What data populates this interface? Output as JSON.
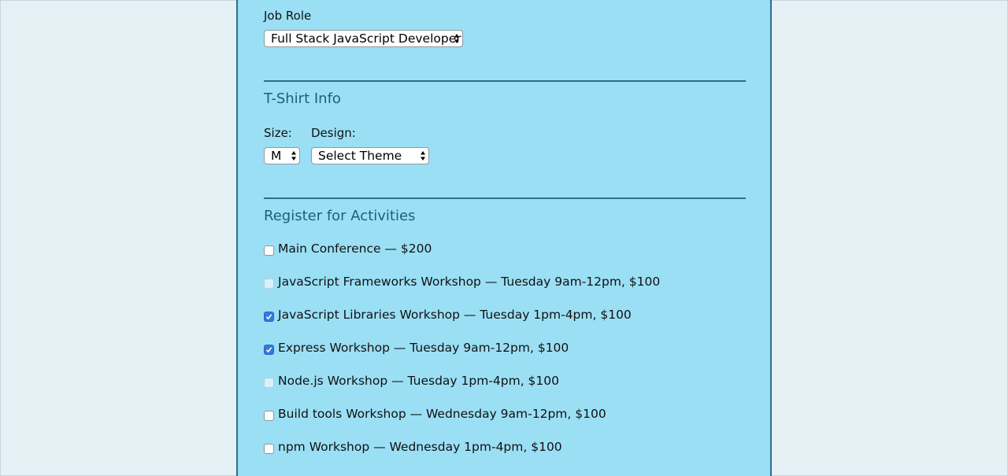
{
  "job_role": {
    "label": "Job Role",
    "selected": "Full Stack JavaScript Developer"
  },
  "tshirt": {
    "title": "T-Shirt Info",
    "size_label": "Size:",
    "size_selected": "M",
    "design_label": "Design:",
    "design_selected": "Select Theme"
  },
  "activities": {
    "title": "Register for Activities",
    "items": [
      {
        "label": "Main Conference — $200",
        "checked": false,
        "disabled": false
      },
      {
        "label": "JavaScript Frameworks Workshop — Tuesday 9am-12pm, $100",
        "checked": false,
        "disabled": true
      },
      {
        "label": "JavaScript Libraries Workshop — Tuesday 1pm-4pm, $100",
        "checked": true,
        "disabled": false
      },
      {
        "label": "Express Workshop — Tuesday 9am-12pm, $100",
        "checked": true,
        "disabled": false
      },
      {
        "label": "Node.js Workshop — Tuesday 1pm-4pm, $100",
        "checked": false,
        "disabled": true
      },
      {
        "label": "Build tools Workshop — Wednesday 9am-12pm, $100",
        "checked": false,
        "disabled": false
      },
      {
        "label": "npm Workshop — Wednesday 1pm-4pm, $100",
        "checked": false,
        "disabled": false
      }
    ]
  },
  "colors": {
    "page_background": "#e5f0f5",
    "form_background": "#9bdff5",
    "accent": "#2a6f8a",
    "heading": "#1e5f78",
    "checkbox_checked": "#3478e0"
  }
}
